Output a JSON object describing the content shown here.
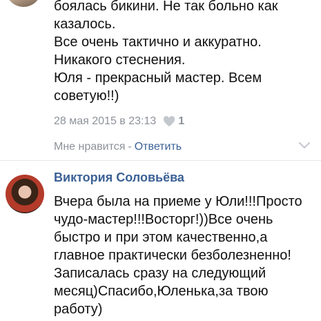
{
  "comments": [
    {
      "author": "",
      "text": "боялась бикини. Не так больно как\nказалось.\nВсе очень тактично и аккуратно.\nНикакого стеснения.\nЮля - прекрасный мастер. Всем\nсоветую!!)",
      "timestamp": "28 мая 2015 в 23:13",
      "likes": "1",
      "like_label": "Мне нравится",
      "separator": "-",
      "reply_label": "Ответить"
    },
    {
      "author": "Виктория Соловьёва",
      "text": "Вчера была на приеме у Юли!!!Просто\nчудо-мастер!!!Восторг!))Все очень\nбыстро и при этом качественно,а\nглавное практически безболезненно!\nЗаписалась сразу на следующий\nмесяц)Спасибо,Юленька,за твою\nработу)"
    }
  ],
  "colors": {
    "link": "#3b6196",
    "meta": "#8d9298",
    "text": "#111111"
  },
  "icons": [
    "heart-icon",
    "chevron-down-icon"
  ]
}
